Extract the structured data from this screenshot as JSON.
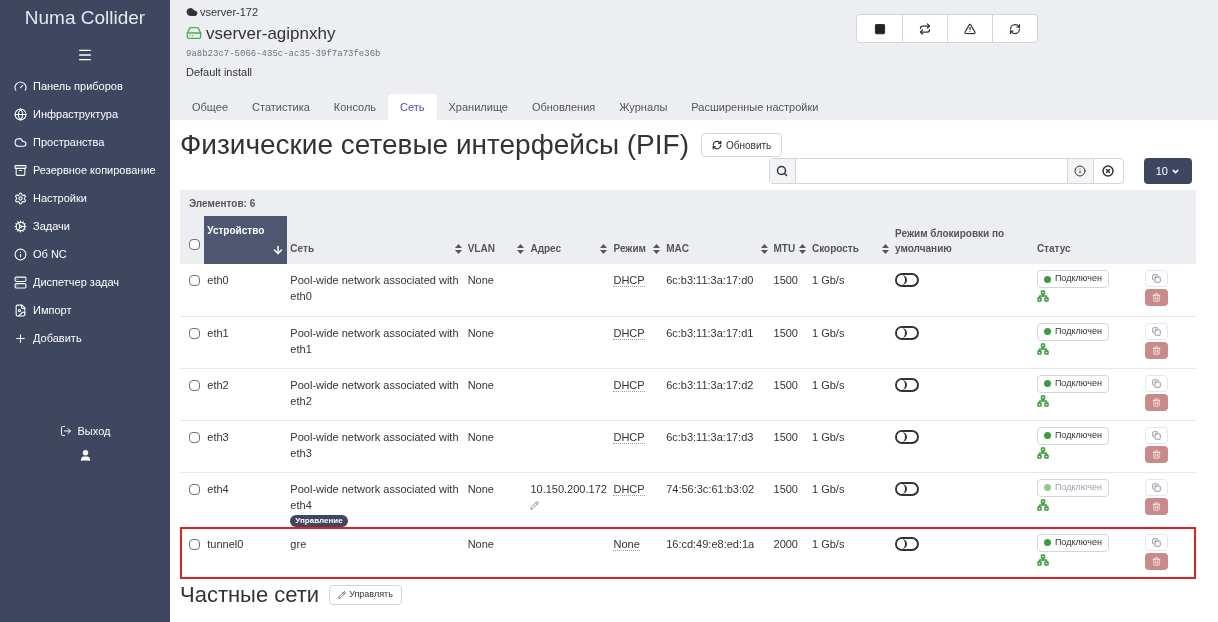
{
  "sidebar": {
    "brand": "Numa Collider",
    "items": [
      {
        "label": "Панель приборов"
      },
      {
        "label": "Инфраструктура"
      },
      {
        "label": "Пространства"
      },
      {
        "label": "Резервное копирование"
      },
      {
        "label": "Настройки"
      },
      {
        "label": "Задачи"
      },
      {
        "label": "Об NC"
      },
      {
        "label": "Диспетчер задач"
      },
      {
        "label": "Импорт"
      },
      {
        "label": "Добавить"
      }
    ],
    "logout": "Выход"
  },
  "header": {
    "pool": "vserver-172",
    "host": "vserver-agipnxhy",
    "uuid": "9a8b23c7-5066-435c-ac35-39f7a73fe36b",
    "description": "Default install"
  },
  "tabs": [
    {
      "label": "Общее",
      "selected": false
    },
    {
      "label": "Статистика",
      "selected": false
    },
    {
      "label": "Консоль",
      "selected": false
    },
    {
      "label": "Сеть",
      "selected": true
    },
    {
      "label": "Хранилище",
      "selected": false
    },
    {
      "label": "Обновления",
      "selected": false
    },
    {
      "label": "Журналы",
      "selected": false
    },
    {
      "label": "Расширенные настройки",
      "selected": false
    }
  ],
  "section": {
    "title": "Физические сетевые интерфейсы (PIF)",
    "refresh_button": "Обновить",
    "page_size": "10",
    "count": "Элементов: 6"
  },
  "table": {
    "select_all_checked": false,
    "columns": [
      {
        "label": "Устройство",
        "sortable": true,
        "selected": true
      },
      {
        "label": "Сеть",
        "sortable": true,
        "selected": false
      },
      {
        "label": "VLAN",
        "sortable": true,
        "selected": false
      },
      {
        "label": "Адрес",
        "sortable": true,
        "selected": false
      },
      {
        "label": "Режим",
        "sortable": true,
        "selected": false
      },
      {
        "label": "MAC",
        "sortable": true,
        "selected": false
      },
      {
        "label": "MTU",
        "sortable": true,
        "selected": false
      },
      {
        "label": "Скорость",
        "sortable": true,
        "selected": false
      },
      {
        "label": "Режим блокировки по умолчанию",
        "sortable": false,
        "selected": false
      },
      {
        "label": "Статус",
        "sortable": false,
        "selected": false
      }
    ],
    "rows": [
      {
        "checked": false,
        "device": "eth0",
        "network": "Pool-wide network associated with eth0",
        "vlan": "None",
        "mode": "DHCP",
        "mac": "6c:b3:11:3a:17:d0",
        "mtu": "1500",
        "speed": "1 Gb/s",
        "locked": false,
        "status": "Подключен",
        "status_enabled": true,
        "highlighted": false
      },
      {
        "checked": false,
        "device": "eth1",
        "network": "Pool-wide network associated with eth1",
        "vlan": "None",
        "mode": "DHCP",
        "mac": "6c:b3:11:3a:17:d1",
        "mtu": "1500",
        "speed": "1 Gb/s",
        "locked": false,
        "status": "Подключен",
        "status_enabled": true,
        "highlighted": false
      },
      {
        "checked": false,
        "device": "eth2",
        "network": "Pool-wide network associated with eth2",
        "vlan": "None",
        "mode": "DHCP",
        "mac": "6c:b3:11:3a:17:d2",
        "mtu": "1500",
        "speed": "1 Gb/s",
        "locked": false,
        "status": "Подключен",
        "status_enabled": true,
        "highlighted": false
      },
      {
        "checked": false,
        "device": "eth3",
        "network": "Pool-wide network associated with eth3",
        "vlan": "None",
        "mode": "DHCP",
        "mac": "6c:b3:11:3a:17:d3",
        "mtu": "1500",
        "speed": "1 Gb/s",
        "locked": false,
        "status": "Подключен",
        "status_enabled": true,
        "highlighted": false
      },
      {
        "checked": false,
        "device": "eth4",
        "network": "Pool-wide network associated with eth4",
        "badge": "Управление",
        "vlan": "None",
        "address": "10.150.200.172",
        "mode": "DHCP",
        "mac": "74:56:3c:61:b3:02",
        "mtu": "1500",
        "speed": "1 Gb/s",
        "locked": false,
        "status": "Подключен",
        "status_enabled": false,
        "highlighted": false
      },
      {
        "checked": false,
        "device": "tunnel0",
        "network": "gre",
        "vlan": "None",
        "mode": "None",
        "mac": "16:cd:49:e8:ed:1a",
        "mtu": "2000",
        "speed": "1 Gb/s",
        "locked": false,
        "status": "Подключен",
        "status_enabled": true,
        "highlighted": true
      }
    ]
  },
  "next_section": {
    "title": "Частные сети",
    "button": "Управлять"
  }
}
